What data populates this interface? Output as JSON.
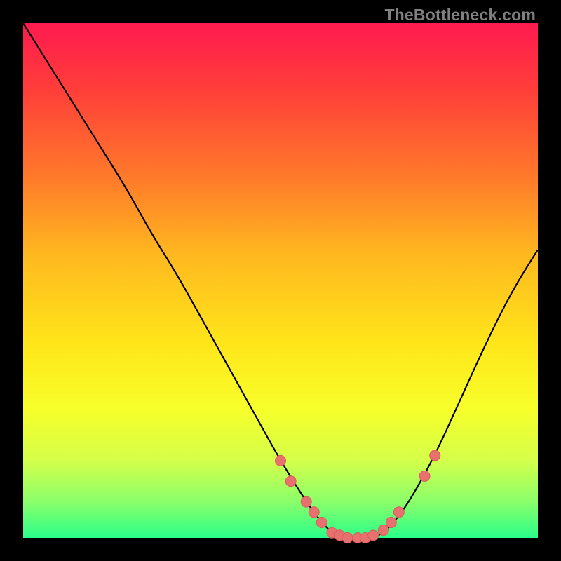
{
  "watermark": "TheBottleneck.com",
  "colors": {
    "background": "#000000",
    "gradient_top": "#ff1a4f",
    "gradient_bottom": "#2aff8a",
    "curve": "#000000",
    "dot_fill": "#e8716f",
    "dot_stroke": "#d85a58",
    "watermark": "#808080"
  },
  "chart_data": {
    "type": "line",
    "title": "",
    "xlabel": "",
    "ylabel": "",
    "xlim": [
      0,
      100
    ],
    "ylim": [
      0,
      100
    ],
    "series": [
      {
        "name": "bottleneck-curve",
        "x": [
          0,
          5,
          10,
          15,
          20,
          25,
          30,
          35,
          40,
          45,
          50,
          55,
          58,
          60,
          62,
          64,
          66,
          68,
          70,
          72,
          75,
          80,
          85,
          90,
          95,
          100
        ],
        "y": [
          100,
          92,
          84,
          76,
          68,
          59,
          51,
          42,
          33,
          24,
          15,
          7,
          3,
          1,
          0,
          0,
          0,
          0,
          1,
          3,
          7,
          16,
          27,
          38,
          48,
          56
        ]
      }
    ],
    "markers": [
      {
        "x": 50,
        "y": 15
      },
      {
        "x": 52,
        "y": 11
      },
      {
        "x": 55,
        "y": 7
      },
      {
        "x": 56.5,
        "y": 5
      },
      {
        "x": 58,
        "y": 3
      },
      {
        "x": 60,
        "y": 1
      },
      {
        "x": 61.5,
        "y": 0.5
      },
      {
        "x": 63,
        "y": 0
      },
      {
        "x": 65,
        "y": 0
      },
      {
        "x": 66.5,
        "y": 0
      },
      {
        "x": 68,
        "y": 0.5
      },
      {
        "x": 70,
        "y": 1.5
      },
      {
        "x": 71.5,
        "y": 3
      },
      {
        "x": 73,
        "y": 5
      },
      {
        "x": 78,
        "y": 12
      },
      {
        "x": 80,
        "y": 16
      }
    ]
  }
}
